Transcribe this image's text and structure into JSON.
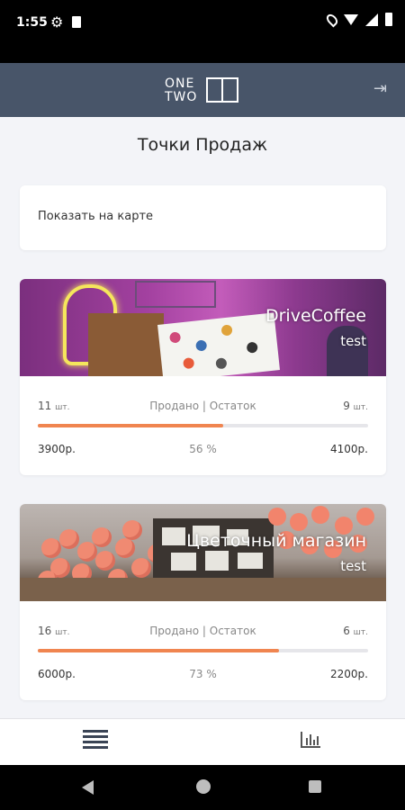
{
  "status_bar": {
    "time": "1:55",
    "icons": [
      "gear-icon",
      "sd-card-icon",
      "location-icon",
      "wifi-icon",
      "signal-icon",
      "battery-icon"
    ]
  },
  "app_bar": {
    "logo_line1": "ONE",
    "logo_line2": "TWO",
    "logout_icon": "logout-icon",
    "background": "#485569"
  },
  "page": {
    "title": "Точки Продаж",
    "map_link": "Показать на карте"
  },
  "stores": [
    {
      "name": "DriveCoffee",
      "subtitle": "test",
      "sold": "11",
      "remaining": "9",
      "unit": "шт.",
      "labels": "Продано | Остаток",
      "sold_amount": "3900р.",
      "percent": "56 %",
      "percent_value": 56,
      "remaining_amount": "4100р."
    },
    {
      "name": "Цветочный магазин",
      "subtitle": "test",
      "sold": "16",
      "remaining": "6",
      "unit": "шт.",
      "labels": "Продано | Остаток",
      "sold_amount": "6000р.",
      "percent": "73 %",
      "percent_value": 73,
      "remaining_amount": "2200р."
    }
  ],
  "bottom_nav": {
    "items": [
      "list-icon",
      "statistics-icon"
    ]
  },
  "colors": {
    "accent": "#f08550",
    "header": "#485569"
  }
}
